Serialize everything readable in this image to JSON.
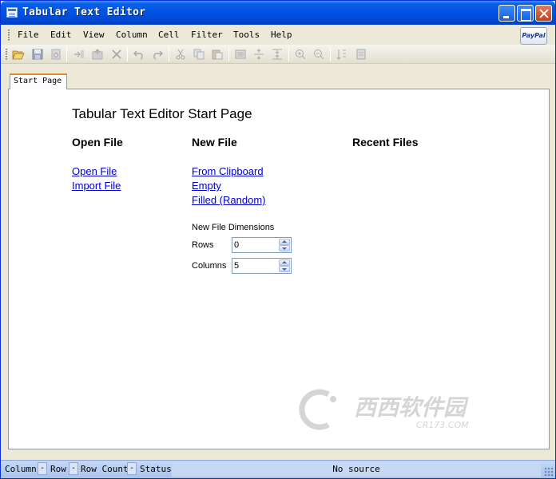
{
  "window": {
    "title": "Tabular Text Editor"
  },
  "menu": {
    "items": [
      "File",
      "Edit",
      "View",
      "Column",
      "Cell",
      "Filter",
      "Tools",
      "Help"
    ],
    "paypal_label": "PayPal"
  },
  "toolbar": {
    "icons": [
      "open-folder-icon",
      "save-icon",
      "reload-icon",
      "insert-row-icon",
      "export-icon",
      "delete-icon",
      "undo-icon",
      "redo-icon",
      "cut-icon",
      "copy-icon",
      "paste-icon",
      "properties-icon",
      "split-icon",
      "merge-icon",
      "zoom-in-icon",
      "zoom-out-icon",
      "sort-icon",
      "filter-icon"
    ]
  },
  "tabs": [
    {
      "label": "Start Page",
      "active": true
    }
  ],
  "start_page": {
    "title": "Tabular Text Editor Start Page",
    "open_file": {
      "heading": "Open File",
      "links": [
        "Open File",
        "Import File"
      ]
    },
    "new_file": {
      "heading": "New File",
      "links": [
        "From Clipboard",
        "Empty",
        "Filled (Random)"
      ],
      "dimensions_label": "New File Dimensions",
      "rows_label": "Rows",
      "rows_value": "0",
      "columns_label": "Columns",
      "columns_value": "5"
    },
    "recent_files": {
      "heading": "Recent Files"
    }
  },
  "watermark": {
    "text": "西西软件园",
    "subtext": "CR173.COM"
  },
  "statusbar": {
    "segments": [
      "Column",
      "Row",
      "Row Count",
      "Status"
    ],
    "dash": "-",
    "source": "No source"
  },
  "colors": {
    "titlebar": "#0054e3",
    "link": "#0000cc",
    "tab_accent": "#e68b2c",
    "statusbar": "#a9c3ec"
  }
}
